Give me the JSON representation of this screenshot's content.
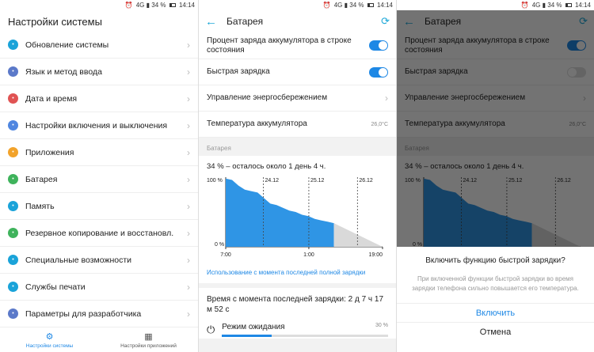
{
  "status": {
    "signal": "4G",
    "battery_pct": "34 %",
    "time": "14:14"
  },
  "settings": {
    "title": "Настройки системы",
    "items": [
      {
        "label": "Обновление системы",
        "icon": "update-icon",
        "color": "#1aa3d9"
      },
      {
        "label": "Язык и метод ввода",
        "icon": "language-icon",
        "color": "#5b79c9"
      },
      {
        "label": "Дата и время",
        "icon": "clock-icon",
        "color": "#e05353"
      },
      {
        "label": "Настройки включения и выключения",
        "icon": "power-icon",
        "color": "#4f86e0"
      },
      {
        "label": "Приложения",
        "icon": "apps-icon",
        "color": "#f2a32b"
      },
      {
        "label": "Батарея",
        "icon": "battery-icon",
        "color": "#3fb35c"
      },
      {
        "label": "Память",
        "icon": "memory-icon",
        "color": "#1aa3d9"
      },
      {
        "label": "Резервное копирование и восстановл.",
        "icon": "backup-icon",
        "color": "#3fb35c"
      },
      {
        "label": "Специальные возможности",
        "icon": "accessibility-icon",
        "color": "#1aa3d9"
      },
      {
        "label": "Службы печати",
        "icon": "print-icon",
        "color": "#1aa3d9"
      },
      {
        "label": "Параметры для разработчика",
        "icon": "developer-icon",
        "color": "#5b79c9"
      }
    ],
    "bottom_nav": {
      "system": "Настройки системы",
      "apps": "Настройки приложений"
    }
  },
  "battery": {
    "title": "Батарея",
    "rows": {
      "percent_in_status": "Процент заряда аккумулятора в строке состояния",
      "fast_charge": "Быстрая зарядка",
      "power_saving": "Управление энергосбережением",
      "temperature": "Температура аккумулятора",
      "temperature_value": "26,0°C"
    },
    "section": "Батарея",
    "summary": "34 % – осталось около 1 день 4 ч.",
    "usage_link": "Использование с момента последней полной зарядки",
    "since_charge": "Время с момента последней зарядки: 2 д 7 ч 17 м 52 с",
    "standby": {
      "label": "Режим ожидания",
      "pct": "30 %",
      "fraction": 0.3
    }
  },
  "dialog": {
    "title": "Включить функцию быстрой зарядки?",
    "message": "При включенной функции быстрой зарядки во время зарядки телефона сильно повышается его температура.",
    "confirm": "Включить",
    "cancel": "Отмена"
  },
  "chart_data": {
    "type": "area",
    "ylabels": [
      "100 %",
      "0 %"
    ],
    "xlabels": [
      "7:00",
      "1:00",
      "19:00"
    ],
    "date_markers": [
      "24.12",
      "25.12",
      "26.12"
    ],
    "series": [
      {
        "values": [
          98,
          96,
          88,
          82,
          80,
          78,
          70,
          62,
          60,
          56,
          52,
          50,
          46,
          44,
          40,
          38,
          36,
          34
        ]
      }
    ],
    "projection": [
      34,
      0
    ]
  }
}
